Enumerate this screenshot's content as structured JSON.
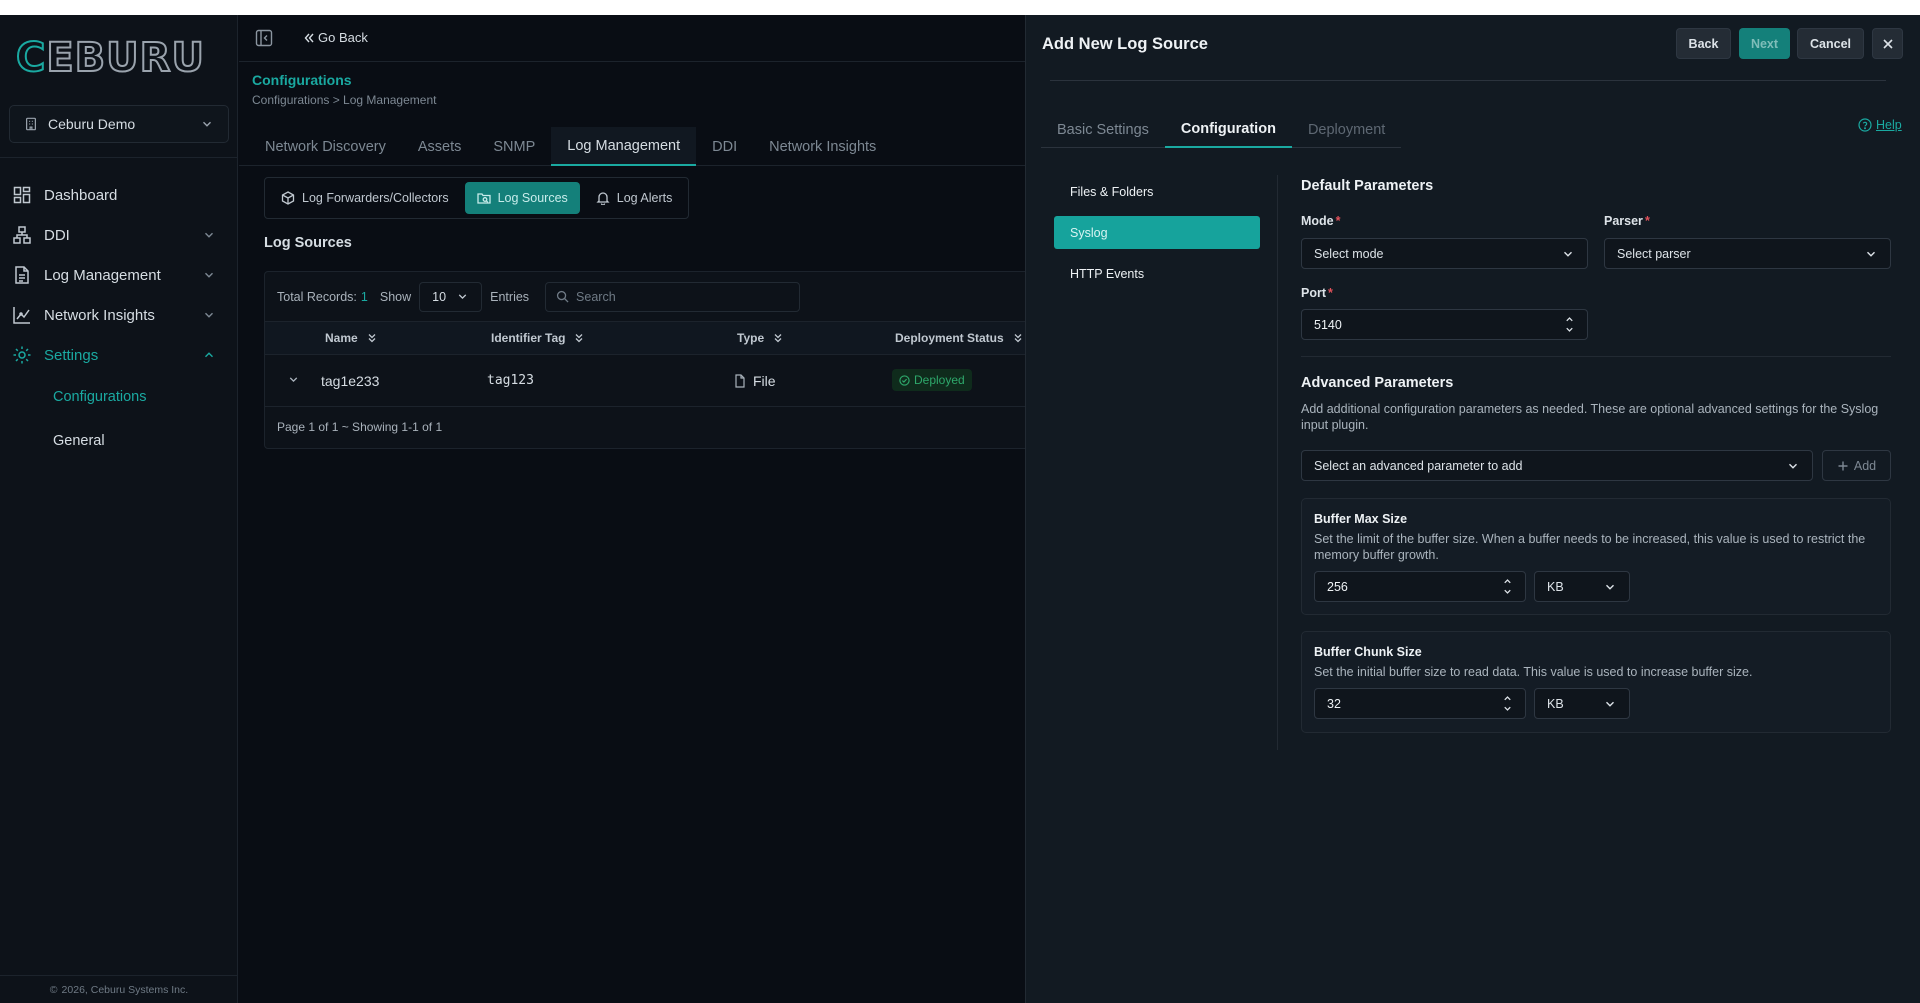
{
  "app": {
    "logo": "CEBURU",
    "org_name": "Ceburu Demo",
    "copyright": "2026, Ceburu Systems Inc."
  },
  "sidebar": {
    "items": [
      {
        "label": "Dashboard",
        "icon": "dashboard-icon"
      },
      {
        "label": "DDI",
        "icon": "network-icon"
      },
      {
        "label": "Log Management",
        "icon": "document-icon"
      },
      {
        "label": "Network Insights",
        "icon": "chart-icon"
      },
      {
        "label": "Settings",
        "icon": "gear-icon"
      }
    ],
    "sub_items": [
      {
        "label": "Configurations"
      },
      {
        "label": "General"
      }
    ]
  },
  "header": {
    "go_back": "Go Back",
    "title": "Configurations",
    "breadcrumb": "Configurations > Log Management"
  },
  "main_tabs": [
    "Network Discovery",
    "Assets",
    "SNMP",
    "Log Management",
    "DDI",
    "Network Insights"
  ],
  "sub_tabs": [
    "Log Forwarders/Collectors",
    "Log Sources",
    "Log Alerts"
  ],
  "log_sources": {
    "title": "Log Sources",
    "total_label": "Total Records:",
    "total": "1",
    "show_label": "Show",
    "show_value": "10",
    "entries_label": "Entries",
    "search_placeholder": "Search",
    "columns": [
      "Name",
      "Identifier Tag",
      "Type",
      "Deployment Status"
    ],
    "rows": [
      {
        "name": "tag1e233",
        "identifier": "tag123",
        "type": "File",
        "status": "Deployed"
      }
    ],
    "footer": "Page 1 of 1 ~ Showing 1-1 of 1"
  },
  "drawer": {
    "title": "Add New Log Source",
    "buttons": {
      "back": "Back",
      "next": "Next",
      "cancel": "Cancel"
    },
    "tabs": [
      "Basic Settings",
      "Configuration",
      "Deployment"
    ],
    "help": "Help",
    "side_menu": [
      "Files & Folders",
      "Syslog",
      "HTTP Events"
    ],
    "default_params": {
      "title": "Default Parameters",
      "mode_label": "Mode",
      "mode_placeholder": "Select mode",
      "parser_label": "Parser",
      "parser_placeholder": "Select parser",
      "port_label": "Port",
      "port_value": "5140",
      "required_mark": "*"
    },
    "advanced": {
      "title": "Advanced Parameters",
      "description": "Add additional configuration parameters as needed. These are optional advanced settings for the Syslog input plugin.",
      "select_placeholder": "Select an advanced parameter to add",
      "add_label": "Add",
      "params": [
        {
          "title": "Buffer Max Size",
          "description": "Set the limit of the buffer size. When a buffer needs to be increased, this value is used to restrict the memory buffer growth.",
          "value": "256",
          "unit": "KB"
        },
        {
          "title": "Buffer Chunk Size",
          "description": "Set the initial buffer size to read data. This value is used to increase buffer size.",
          "value": "32",
          "unit": "KB"
        }
      ]
    }
  },
  "colors": {
    "accent": "#1aa9a1",
    "background": "#090d14",
    "drawer": "#121a22",
    "required": "#e0515a",
    "success": "#2ea86b"
  }
}
